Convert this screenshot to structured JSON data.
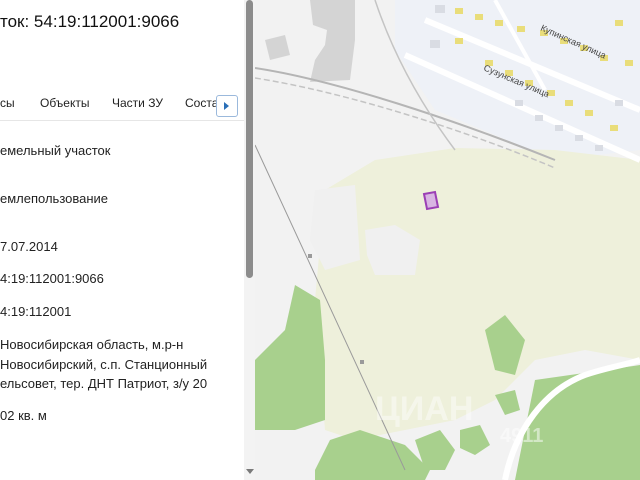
{
  "panel": {
    "title": "ток: 54:19:112001:9066",
    "tabs": [
      {
        "label": "сы"
      },
      {
        "label": "Объекты"
      },
      {
        "label": "Части ЗУ"
      },
      {
        "label": "Соста"
      }
    ],
    "fields": {
      "type": "емельный участок",
      "use": "емлепользование",
      "date": "7.07.2014",
      "cadastral_number": "4:19:112001:9066",
      "quarter": "4:19:112001",
      "address_line1": "Новосибирская область, м.р-н",
      "address_line2": "Новосибирский, с.п. Станционный",
      "address_line3": "ельсовет, тер. ДНТ Патриот, з/у 20",
      "area": "02 кв. м"
    }
  },
  "map": {
    "street1": "Купинская улица",
    "street2": "Сузунская улица",
    "watermark_text": "ЦИАН",
    "watermark_number": "4911",
    "colors": {
      "field": "#eef0db",
      "forest": "#a8d08d",
      "background": "#f2f2f2",
      "parcel": "#9b3fb5",
      "road": "#ffffff"
    }
  }
}
